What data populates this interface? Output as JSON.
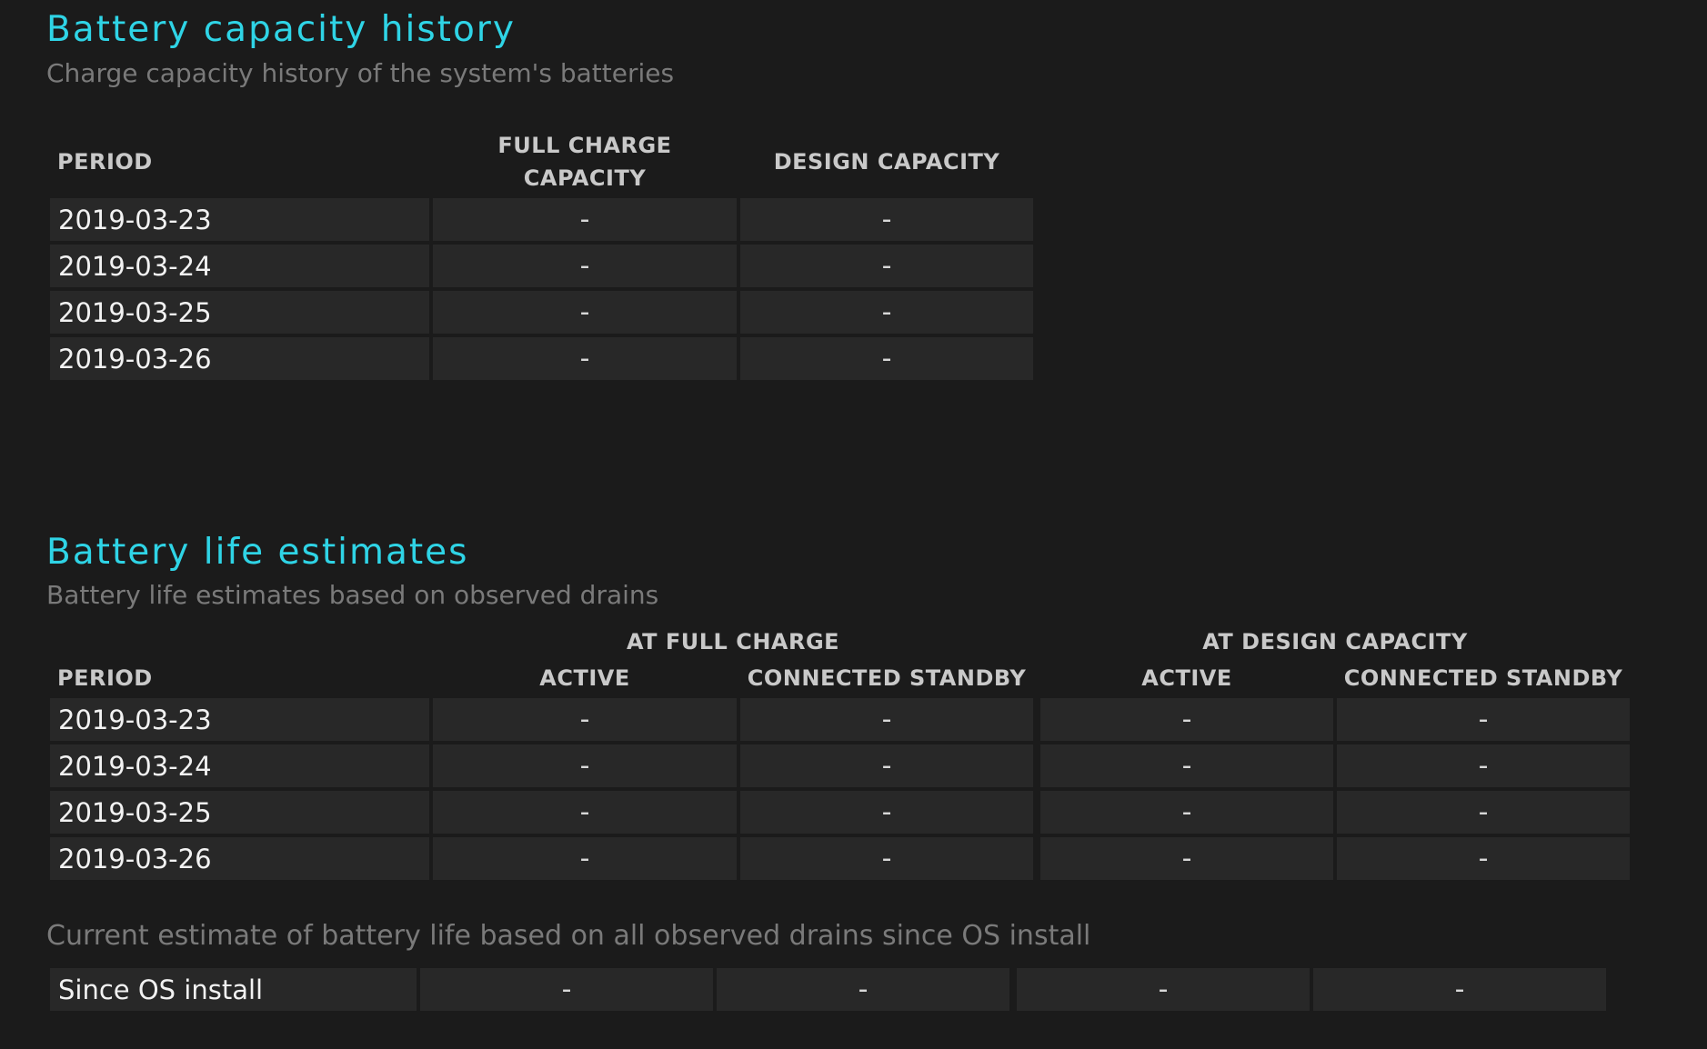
{
  "capacity_history": {
    "title": "Battery capacity history",
    "subtitle": "Charge capacity history of the system's batteries",
    "headers": {
      "period": "PERIOD",
      "full_charge_line1": "FULL CHARGE",
      "full_charge_line2": "CAPACITY",
      "design_capacity": "DESIGN CAPACITY"
    },
    "rows": [
      {
        "period": "2019-03-23",
        "full": "-",
        "design": "-"
      },
      {
        "period": "2019-03-24",
        "full": "-",
        "design": "-"
      },
      {
        "period": "2019-03-25",
        "full": "-",
        "design": "-"
      },
      {
        "period": "2019-03-26",
        "full": "-",
        "design": "-"
      }
    ]
  },
  "life_estimates": {
    "title": "Battery life estimates",
    "subtitle": "Battery life estimates based on observed drains",
    "group_headers": {
      "full_charge": "AT FULL CHARGE",
      "design_capacity": "AT DESIGN CAPACITY"
    },
    "headers": {
      "period": "PERIOD",
      "active": "ACTIVE",
      "connected_standby": "CONNECTED STANDBY",
      "active2": "ACTIVE",
      "connected_standby2": "CONNECTED STANDBY"
    },
    "rows": [
      {
        "period": "2019-03-23",
        "fc_active": "-",
        "fc_standby": "-",
        "dc_active": "-",
        "dc_standby": "-"
      },
      {
        "period": "2019-03-24",
        "fc_active": "-",
        "fc_standby": "-",
        "dc_active": "-",
        "dc_standby": "-"
      },
      {
        "period": "2019-03-25",
        "fc_active": "-",
        "fc_standby": "-",
        "dc_active": "-",
        "dc_standby": "-"
      },
      {
        "period": "2019-03-26",
        "fc_active": "-",
        "fc_standby": "-",
        "dc_active": "-",
        "dc_standby": "-"
      }
    ],
    "note": "Current estimate of battery life based on all observed drains since OS install",
    "since_install": {
      "period": "Since OS install",
      "fc_active": "-",
      "fc_standby": "-",
      "dc_active": "-",
      "dc_standby": "-"
    }
  }
}
